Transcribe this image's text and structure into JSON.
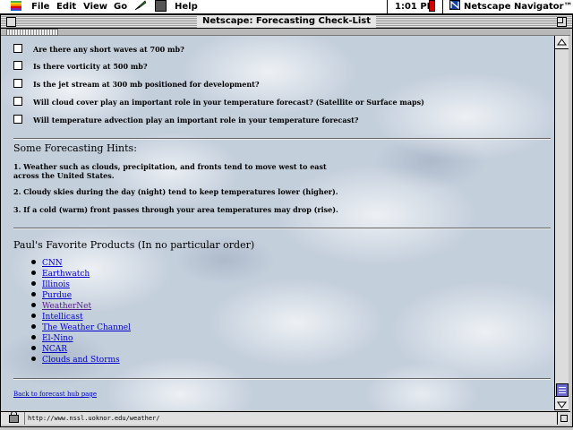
{
  "menubar": {
    "apple_icon": "apple-icon",
    "menus": [
      "File",
      "Edit",
      "View",
      "Go"
    ],
    "help": "Help",
    "clock": "1:01 PM",
    "app_name": "Netscape Navigator™"
  },
  "window": {
    "title": "Netscape: Forecasting Check-List"
  },
  "checklist": [
    "Are there any short waves at 700 mb?",
    "Is there vorticity at 500 mb?",
    "Is the jet stream at 300 mb positioned for development?",
    "Will cloud cover play an important role in your temperature forecast? (Satellite or Surface maps)",
    "Will temperature advection play an important role in your temperature forecast?"
  ],
  "hints": {
    "heading": "Some Forecasting Hints:",
    "items": [
      "1. Weather such as clouds, precipitation, and fronts tend to move west to east across the United States.",
      "2. Cloudy skies during the day (night) tend to keep temperatures lower (higher).",
      "3. If a cold (warm) front passes through your area temperatures may drop (rise)."
    ]
  },
  "products": {
    "heading": "Paul's Favorite Products (In no particular order)",
    "items": [
      {
        "label": "CNN",
        "visited": false
      },
      {
        "label": "Earthwatch",
        "visited": false
      },
      {
        "label": "Illinois",
        "visited": false
      },
      {
        "label": "Purdue",
        "visited": false
      },
      {
        "label": "WeatherNet",
        "visited": true
      },
      {
        "label": "Intellicast",
        "visited": false
      },
      {
        "label": "The Weather Channel",
        "visited": false
      },
      {
        "label": "El-Nino",
        "visited": false
      },
      {
        "label": "NCAR",
        "visited": false
      },
      {
        "label": "Clouds and Storms",
        "visited": false
      }
    ]
  },
  "footer": {
    "back_link": "Back to forecast hub page"
  },
  "statusbar": {
    "url": "http://www.nssl.uoknor.edu/weather/"
  },
  "colors": {
    "link": "#0000cc",
    "visited_link": "#551a8b",
    "battery": "#d00000",
    "scroll_thumb": "#6a6ad0"
  }
}
